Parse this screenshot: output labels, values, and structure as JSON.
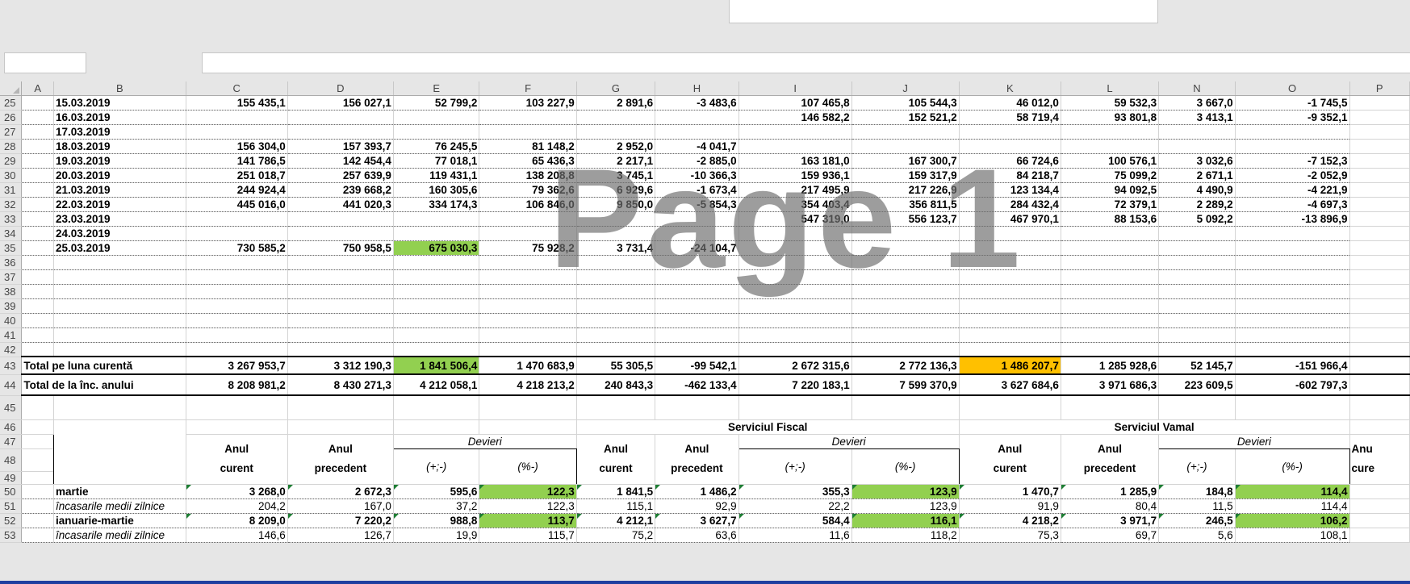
{
  "columns": [
    "A",
    "B",
    "C",
    "D",
    "E",
    "F",
    "G",
    "H",
    "I",
    "J",
    "K",
    "L",
    "N",
    "O",
    "P"
  ],
  "watermark": "Page 1",
  "rows": [
    {
      "n": "25",
      "date": "15.03.2019",
      "v": [
        "155 435,1",
        "156 027,1",
        "52 799,2",
        "103 227,9",
        "2 891,6",
        "-3 483,6",
        "107 465,8",
        "105 544,3",
        "46 012,0",
        "59 532,3",
        "3 667,0",
        "-1 745,5"
      ]
    },
    {
      "n": "26",
      "date": "16.03.2019",
      "v": [
        "",
        "",
        "",
        "",
        "",
        "",
        "146 582,2",
        "152 521,2",
        "58 719,4",
        "93 801,8",
        "3 413,1",
        "-9 352,1"
      ]
    },
    {
      "n": "27",
      "date": "17.03.2019",
      "v": [
        "",
        "",
        "",
        "",
        "",
        "",
        "",
        "",
        "",
        "",
        "",
        ""
      ]
    },
    {
      "n": "28",
      "date": "18.03.2019",
      "v": [
        "156 304,0",
        "157 393,7",
        "76 245,5",
        "81 148,2",
        "2 952,0",
        "-4 041,7",
        "",
        "",
        "",
        "",
        "",
        ""
      ]
    },
    {
      "n": "29",
      "date": "19.03.2019",
      "v": [
        "141 786,5",
        "142 454,4",
        "77 018,1",
        "65 436,3",
        "2 217,1",
        "-2 885,0",
        "163 181,0",
        "167 300,7",
        "66 724,6",
        "100 576,1",
        "3 032,6",
        "-7 152,3"
      ]
    },
    {
      "n": "30",
      "date": "20.03.2019",
      "v": [
        "251 018,7",
        "257 639,9",
        "119 431,1",
        "138 208,8",
        "3 745,1",
        "-10 366,3",
        "159 936,1",
        "159 317,9",
        "84 218,7",
        "75 099,2",
        "2 671,1",
        "-2 052,9"
      ]
    },
    {
      "n": "31",
      "date": "21.03.2019",
      "v": [
        "244 924,4",
        "239 668,2",
        "160 305,6",
        "79 362,6",
        "6 929,6",
        "-1 673,4",
        "217 495,9",
        "217 226,9",
        "123 134,4",
        "94 092,5",
        "4 490,9",
        "-4 221,9"
      ]
    },
    {
      "n": "32",
      "date": "22.03.2019",
      "v": [
        "445 016,0",
        "441 020,3",
        "334 174,3",
        "106 846,0",
        "9 850,0",
        "-5 854,3",
        "354 403,4",
        "356 811,5",
        "284 432,4",
        "72 379,1",
        "2 289,2",
        "-4 697,3"
      ]
    },
    {
      "n": "33",
      "date": "23.03.2019",
      "v": [
        "",
        "",
        "",
        "",
        "",
        "",
        "547 319,0",
        "556 123,7",
        "467 970,1",
        "88 153,6",
        "5 092,2",
        "-13 896,9"
      ]
    },
    {
      "n": "34",
      "date": "24.03.2019",
      "v": [
        "",
        "",
        "",
        "",
        "",
        "",
        "",
        "",
        "",
        "",
        "",
        ""
      ]
    },
    {
      "n": "35",
      "date": "25.03.2019",
      "v": [
        "730 585,2",
        "750 958,5",
        "675 030,3",
        "75 928,2",
        "3 731,4",
        "-24 104,7",
        "",
        "",
        "",
        "",
        "",
        ""
      ]
    }
  ],
  "empty_rows": [
    "36",
    "37",
    "38",
    "39",
    "40",
    "41",
    "42"
  ],
  "totals": [
    {
      "n": "43",
      "label": "Total pe luna curentă",
      "v": [
        "3 267 953,7",
        "3 312 190,3",
        "1 841 506,4",
        "1 470 683,9",
        "55 305,5",
        "-99 542,1",
        "2 672 315,6",
        "2 772 136,3",
        "1 486 207,7",
        "1 285 928,6",
        "52 145,7",
        "-151 966,4"
      ]
    },
    {
      "n": "44",
      "label": "Total de la înc. anului",
      "v": [
        "8 208 981,2",
        "8 430 271,3",
        "4 212 058,1",
        "4 218 213,2",
        "240 843,3",
        "-462 133,4",
        "7 220 183,1",
        "7 599 370,9",
        "3 627 684,6",
        "3 971 686,3",
        "223 609,5",
        "-602 797,3"
      ]
    }
  ],
  "summary_header": {
    "serviciul_fiscal": "Serviciul Fiscal",
    "serviciul_vamal": "Serviciul Vamal",
    "devieri": "Devieri",
    "anul": "Anul",
    "curent": "curent",
    "precedent": "precedent",
    "plus_minus": "(+;-)",
    "percent": "(%-)",
    "anu_trunc": "Anu",
    "cure_trunc": "cure"
  },
  "summary_rows_numbers": {
    "r45": "45",
    "r46": "46",
    "r47": "47",
    "r48": "48",
    "r49": "49"
  },
  "summary": [
    {
      "n": "50",
      "label": "martie",
      "bold": true,
      "v": [
        "3 268,0",
        "2 672,3",
        "595,6",
        "122,3",
        "1 841,5",
        "1 486,2",
        "355,3",
        "123,9",
        "1 470,7",
        "1 285,9",
        "184,8",
        "114,4"
      ]
    },
    {
      "n": "51",
      "label": "încasarile medii zilnice",
      "bold": false,
      "v": [
        "204,2",
        "167,0",
        "37,2",
        "122,3",
        "115,1",
        "92,9",
        "22,2",
        "123,9",
        "91,9",
        "80,4",
        "11,5",
        "114,4"
      ]
    },
    {
      "n": "52",
      "label": "ianuarie-martie",
      "bold": true,
      "v": [
        "8 209,0",
        "7 220,2",
        "988,8",
        "113,7",
        "4 212,1",
        "3 627,7",
        "584,4",
        "116,1",
        "4 218,2",
        "3 971,7",
        "246,5",
        "106,2"
      ]
    },
    {
      "n": "53",
      "label": "încasarile medii zilnice",
      "bold": false,
      "v": [
        "146,6",
        "126,7",
        "19,9",
        "115,7",
        "75,2",
        "63,6",
        "11,6",
        "118,2",
        "75,3",
        "69,7",
        "5,6",
        "108,1"
      ]
    }
  ]
}
